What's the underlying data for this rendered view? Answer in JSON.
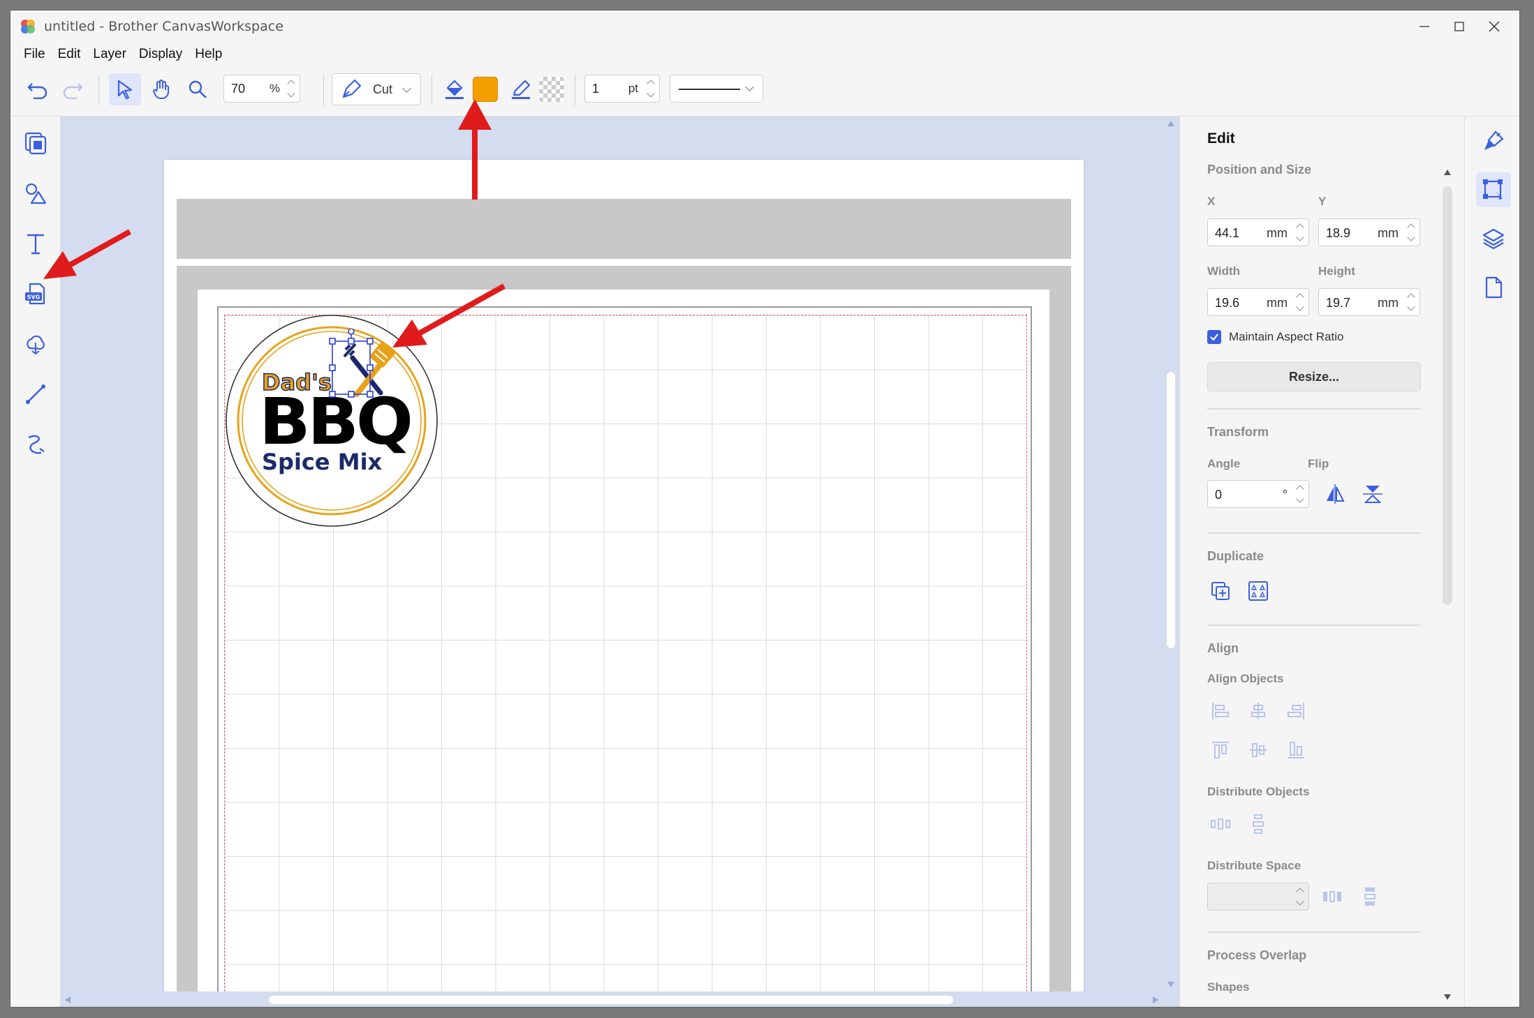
{
  "window": {
    "title": "untitled - Brother CanvasWorkspace"
  },
  "menu": [
    "File",
    "Edit",
    "Layer",
    "Display",
    "Help"
  ],
  "toolbar": {
    "zoom_value": "70",
    "zoom_unit": "%",
    "mode_label": "Cut",
    "fill_color": "#f5a000",
    "stroke_width_value": "1",
    "stroke_width_unit": "pt"
  },
  "left_tools": [
    "pages-icon",
    "shapes-icon",
    "text-icon",
    "svg-import-icon",
    "trace-icon",
    "line-icon",
    "freehand-icon"
  ],
  "canvas": {
    "design": {
      "line1": "Dad's",
      "line2": "BBQ",
      "line3": "Spice Mix"
    }
  },
  "edit_panel": {
    "title": "Edit",
    "position_size": {
      "heading": "Position and Size",
      "x_label": "X",
      "x_value": "44.1",
      "y_label": "Y",
      "y_value": "18.9",
      "width_label": "Width",
      "width_value": "19.6",
      "height_label": "Height",
      "height_value": "19.7",
      "unit": "mm",
      "maintain_aspect_label": "Maintain Aspect Ratio",
      "maintain_aspect_checked": true,
      "resize_label": "Resize..."
    },
    "transform": {
      "heading": "Transform",
      "angle_label": "Angle",
      "angle_value": "0",
      "angle_unit": "°",
      "flip_label": "Flip"
    },
    "duplicate": {
      "heading": "Duplicate"
    },
    "align": {
      "heading": "Align",
      "align_objects_label": "Align Objects",
      "distribute_objects_label": "Distribute Objects",
      "distribute_space_label": "Distribute Space"
    },
    "process_overlap": {
      "heading": "Process Overlap",
      "shapes_label": "Shapes"
    }
  },
  "colors": {
    "accent": "#3a5fe0",
    "canvas_bg": "#d4dcef",
    "annotation": "#e01b1b",
    "logo_orange": "#e8a21a",
    "logo_navy": "#1c2a6b"
  }
}
